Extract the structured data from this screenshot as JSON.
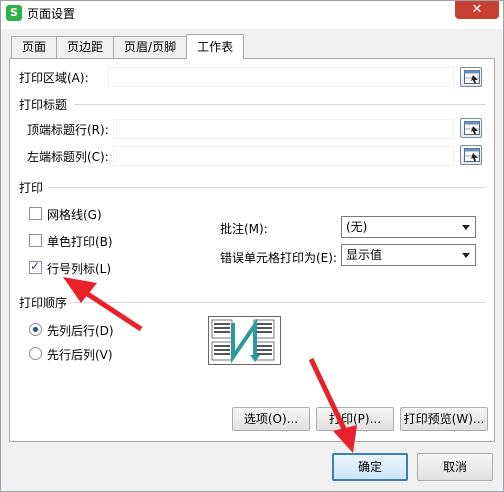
{
  "window": {
    "title": "页面设置",
    "app_icon_glyph": "S",
    "close_glyph": "✕"
  },
  "tabs": [
    {
      "label": "页面",
      "active": false
    },
    {
      "label": "页边距",
      "active": false
    },
    {
      "label": "页眉/页脚",
      "active": false
    },
    {
      "label": "工作表",
      "active": true
    }
  ],
  "print_area": {
    "label": "打印区域(A):",
    "value": ""
  },
  "print_titles": {
    "group": "打印标题",
    "top_rows_label": "顶端标题行(R):",
    "top_rows_value": "",
    "left_cols_label": "左端标题列(C):",
    "left_cols_value": ""
  },
  "print": {
    "group": "打印",
    "gridlines": {
      "label": "网格线(G)",
      "checked": false
    },
    "mono": {
      "label": "单色打印(B)",
      "checked": false
    },
    "row_col_headers": {
      "label": "行号列标(L)",
      "checked": true
    },
    "comments_label": "批注(M):",
    "comments_value": "(无)",
    "errors_label": "错误单元格打印为(E):",
    "errors_value": "显示值"
  },
  "order": {
    "group": "打印顺序",
    "down_then_over": {
      "label": "先列后行(D)",
      "checked": true
    },
    "over_then_down": {
      "label": "先行后列(V)",
      "checked": false
    }
  },
  "buttons": {
    "options": "选项(O)...",
    "print": "打印(P)...",
    "preview": "打印预览(W)...",
    "ok": "确定",
    "cancel": "取消"
  },
  "icons": {
    "range_picker": "range-picker-icon",
    "order_preview": "page-order-preview-icon"
  },
  "colors": {
    "annotation_red": "#e8212a",
    "primary_border": "#3c7fb1",
    "close_red": "#c84031"
  }
}
